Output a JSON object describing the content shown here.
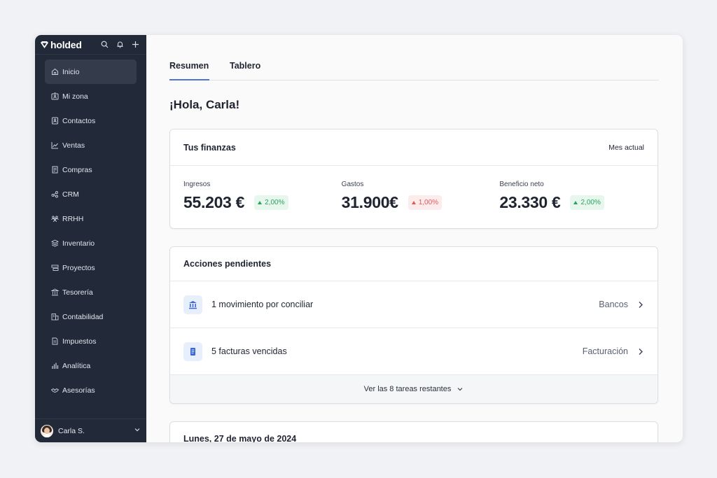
{
  "app": {
    "logo_text": "holded"
  },
  "sidebar": {
    "items": [
      {
        "label": "Inicio",
        "icon": "home-icon"
      },
      {
        "label": "Mi zona",
        "icon": "id-card-icon"
      },
      {
        "label": "Contactos",
        "icon": "contacts-icon"
      },
      {
        "label": "Ventas",
        "icon": "chart-line-icon"
      },
      {
        "label": "Compras",
        "icon": "receipt-icon"
      },
      {
        "label": "CRM",
        "icon": "crm-icon"
      },
      {
        "label": "RRHH",
        "icon": "people-icon"
      },
      {
        "label": "Inventario",
        "icon": "stack-icon"
      },
      {
        "label": "Proyectos",
        "icon": "projects-icon"
      },
      {
        "label": "Tesorería",
        "icon": "bank-icon"
      },
      {
        "label": "Contabilidad",
        "icon": "accounting-icon"
      },
      {
        "label": "Impuestos",
        "icon": "document-icon"
      },
      {
        "label": "Analítica",
        "icon": "bar-chart-icon"
      },
      {
        "label": "Asesorías",
        "icon": "handshake-icon"
      }
    ],
    "active_index": 0,
    "user": {
      "name": "Carla S."
    }
  },
  "tabs": [
    {
      "label": "Resumen",
      "active": true
    },
    {
      "label": "Tablero",
      "active": false
    }
  ],
  "greeting": "¡Hola, Carla!",
  "finances": {
    "title": "Tus finanzas",
    "period": "Mes actual",
    "metrics": [
      {
        "label": "Ingresos",
        "value": "55.203 €",
        "change": "2,00%",
        "direction": "up"
      },
      {
        "label": "Gastos",
        "value": "31.900€",
        "change": "1,00%",
        "direction": "down"
      },
      {
        "label": "Beneficio neto",
        "value": "23.330 €",
        "change": "2,00%",
        "direction": "up"
      }
    ]
  },
  "pending": {
    "title": "Acciones pendientes",
    "items": [
      {
        "text": "1 movimiento por conciliar",
        "target": "Bancos",
        "icon": "bank-icon"
      },
      {
        "text": "5 facturas vencidas",
        "target": "Facturación",
        "icon": "invoice-icon"
      }
    ],
    "more_label": "Ver las 8 tareas restantes"
  },
  "agenda": {
    "date": "Lunes, 27 de mayo de 2024"
  },
  "colors": {
    "sidebar_bg": "#222938",
    "accent": "#4f72d9",
    "positive": "#2aa25a",
    "negative": "#e05a5a"
  }
}
